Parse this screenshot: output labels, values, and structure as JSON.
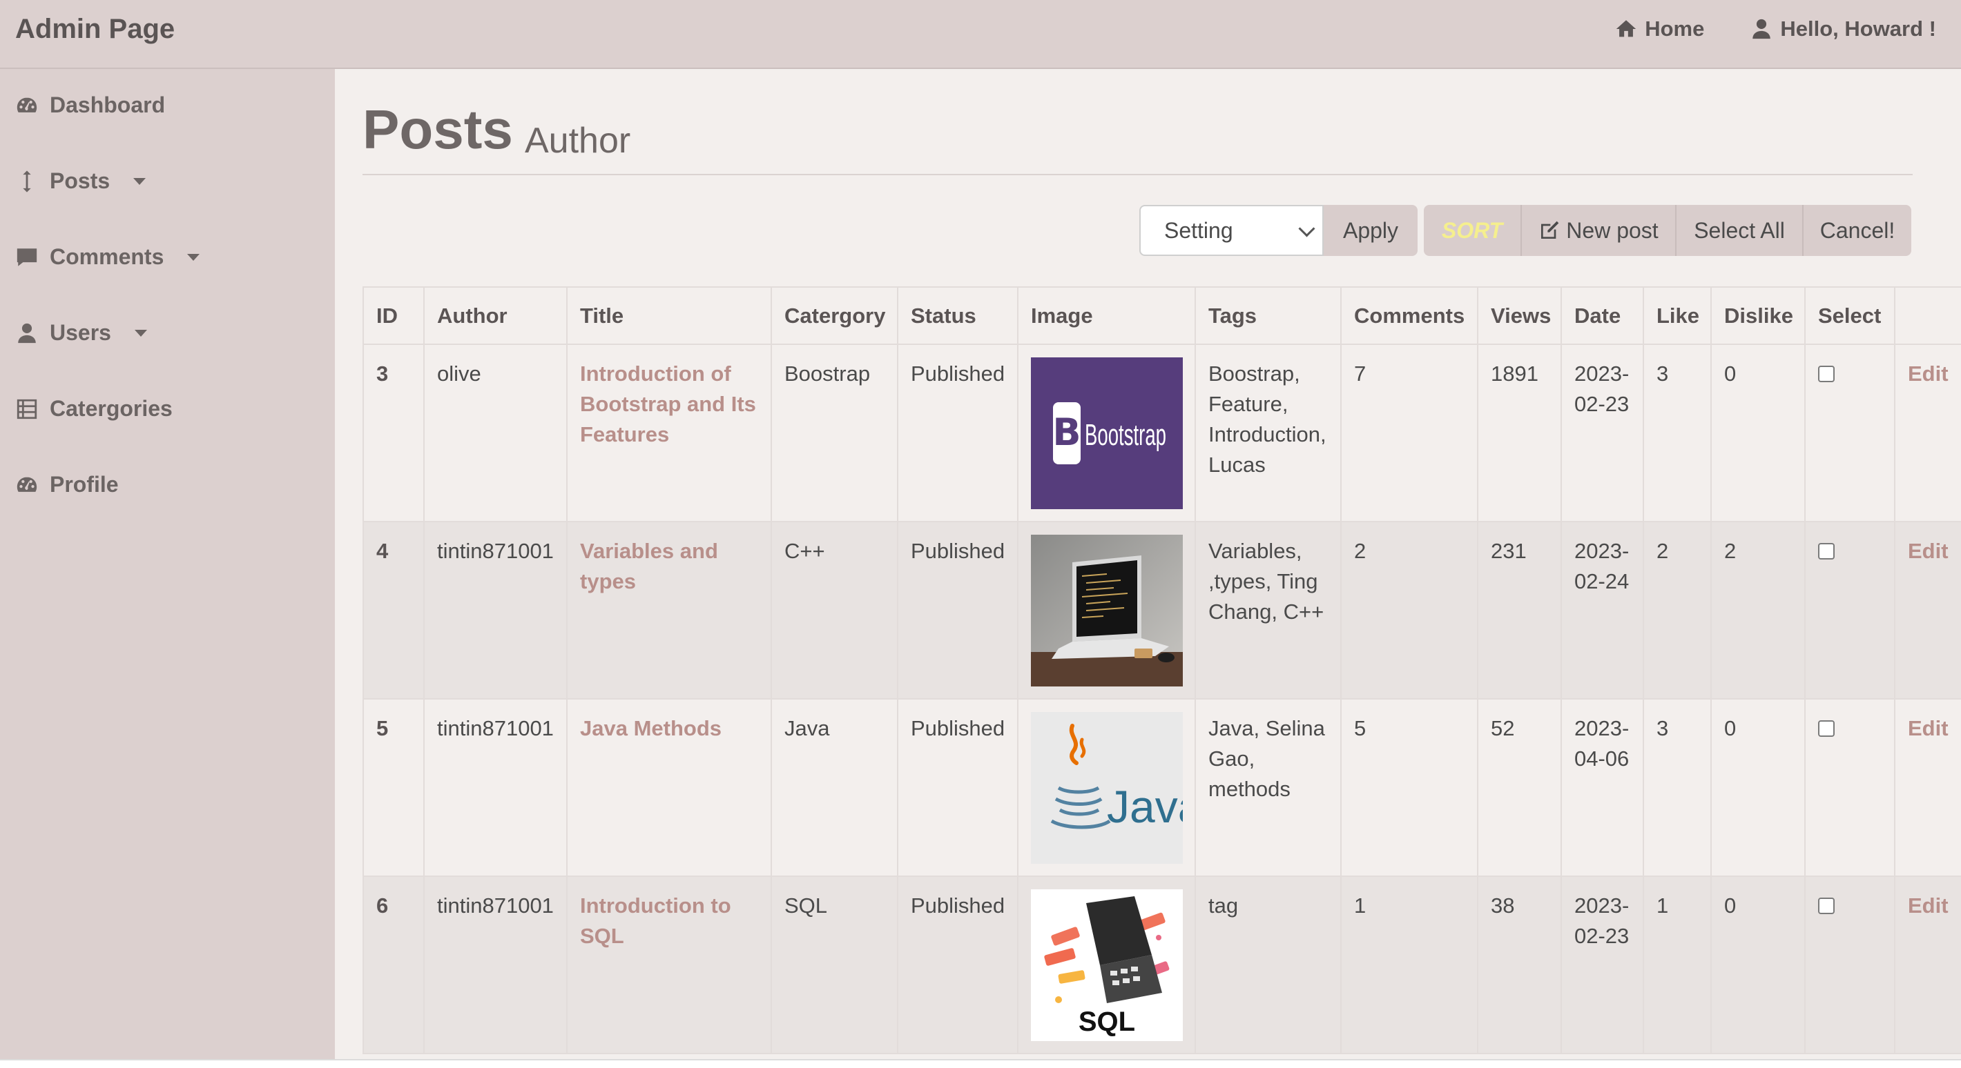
{
  "topbar": {
    "brand": "Admin Page",
    "home_label": "Home",
    "user_label": "Hello, Howard !"
  },
  "sidebar": {
    "items": [
      {
        "label": "Dashboard",
        "icon": "dashboard-icon"
      },
      {
        "label": "Posts",
        "icon": "arrows-vertical-icon"
      },
      {
        "label": "Comments",
        "icon": "comment-icon"
      },
      {
        "label": "Users",
        "icon": "user-icon"
      },
      {
        "label": "Catergories",
        "icon": "list-icon"
      },
      {
        "label": "Profile",
        "icon": "dashboard-icon"
      }
    ]
  },
  "header": {
    "title": "Posts",
    "subtitle": "Author"
  },
  "toolbar": {
    "select_value": "Setting",
    "apply_label": "Apply",
    "sort_label": "SORT",
    "new_post_label": "New post",
    "select_all_label": "Select All",
    "cancel_label": "Cancel!"
  },
  "table": {
    "columns": [
      "ID",
      "Author",
      "Title",
      "Catergory",
      "Status",
      "Image",
      "Tags",
      "Comments",
      "Views",
      "Date",
      "Like",
      "Dislike",
      "Select",
      ""
    ],
    "rows": [
      {
        "id": "3",
        "author": "olive",
        "title": "Introduction of Bootstrap and Its Features",
        "category": "Boostrap",
        "status": "Published",
        "image": "bootstrap-logo",
        "tags": "Boostrap, Feature, Introduction, Lucas",
        "comments": "7",
        "views": "1891",
        "date": "2023-02-23",
        "like": "3",
        "dislike": "0",
        "edit": "Edit"
      },
      {
        "id": "4",
        "author": "tintin871001",
        "title": "Variables and types",
        "category": "C++",
        "status": "Published",
        "image": "laptop-photo",
        "tags": "Variables, ,types, Ting Chang, C++",
        "comments": "2",
        "views": "231",
        "date": "2023-02-24",
        "like": "2",
        "dislike": "2",
        "edit": "Edit"
      },
      {
        "id": "5",
        "author": "tintin871001",
        "title": "Java Methods",
        "category": "Java",
        "status": "Published",
        "image": "java-logo",
        "tags": "Java, Selina Gao, methods",
        "comments": "5",
        "views": "52",
        "date": "2023-04-06",
        "like": "3",
        "dislike": "0",
        "edit": "Edit"
      },
      {
        "id": "6",
        "author": "tintin871001",
        "title": "Introduction to SQL",
        "category": "SQL",
        "status": "Published",
        "image": "sql-illustration",
        "tags": "tag",
        "comments": "1",
        "views": "38",
        "date": "2023-02-23",
        "like": "1",
        "dislike": "0",
        "edit": "Edit"
      }
    ],
    "image_labels": {
      "bootstrap": "Bootstrap",
      "java": "Java",
      "sql": "SQL"
    }
  }
}
